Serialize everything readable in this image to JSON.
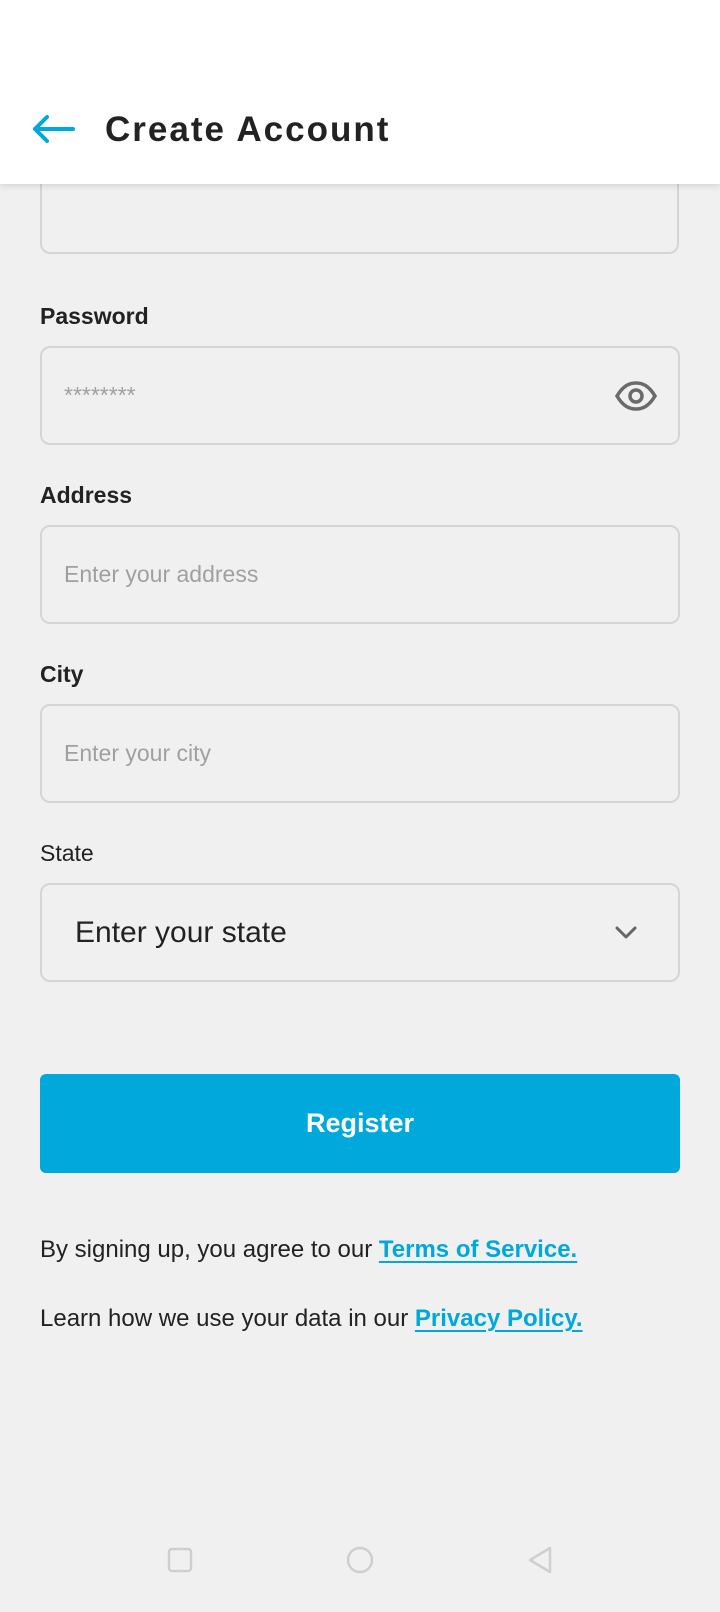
{
  "header": {
    "title": "Create Account",
    "back_icon": "arrow-left-icon"
  },
  "colors": {
    "accent": "#00a8dc",
    "background": "#f0f0f0",
    "text": "#222222",
    "placeholder": "#a0a0a0",
    "border": "#d5d5d5"
  },
  "form": {
    "password": {
      "label": "Password",
      "placeholder": "********",
      "toggle_icon": "eye-icon"
    },
    "address": {
      "label": "Address",
      "placeholder": "Enter your address"
    },
    "city": {
      "label": "City",
      "placeholder": "Enter your city"
    },
    "state": {
      "label": "State",
      "value": "Enter your state",
      "dropdown_icon": "chevron-down-icon"
    },
    "register_label": "Register"
  },
  "legal": {
    "terms_prefix": "By signing up, you agree to our ",
    "terms_link": "Terms of Service.",
    "privacy_prefix": "Learn how we use your data in our ",
    "privacy_link": "Privacy Policy."
  },
  "nav_bar": {
    "recents_icon": "square-icon",
    "home_icon": "circle-icon",
    "back_icon": "triangle-back-icon"
  }
}
